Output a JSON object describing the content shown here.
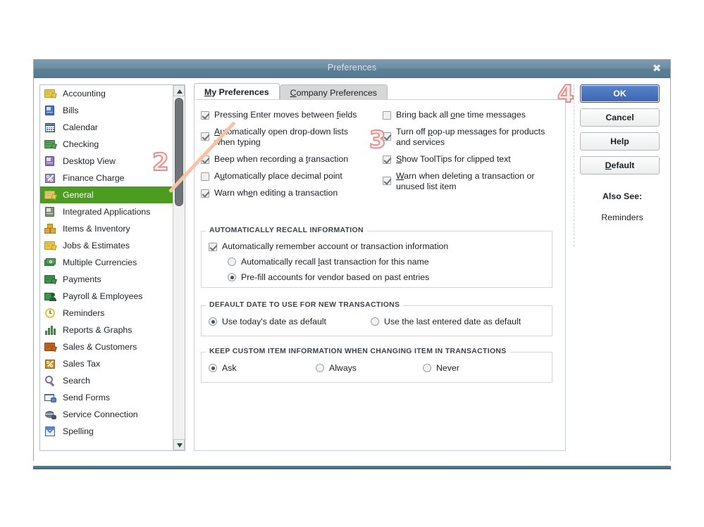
{
  "window": {
    "title": "Preferences",
    "close_icon": "close-icon",
    "close_glyph": "✖"
  },
  "sidebar": {
    "items": [
      {
        "label": "Accounting",
        "icon": "accounting-icon",
        "selected": false
      },
      {
        "label": "Bills",
        "icon": "bills-icon",
        "selected": false
      },
      {
        "label": "Calendar",
        "icon": "calendar-icon",
        "selected": false
      },
      {
        "label": "Checking",
        "icon": "checking-icon",
        "selected": false
      },
      {
        "label": "Desktop View",
        "icon": "desktop-view-icon",
        "selected": false
      },
      {
        "label": "Finance Charge",
        "icon": "finance-charge-icon",
        "selected": false
      },
      {
        "label": "General",
        "icon": "general-icon",
        "selected": true
      },
      {
        "label": "Integrated Applications",
        "icon": "integrated-applications-icon",
        "selected": false
      },
      {
        "label": "Items & Inventory",
        "icon": "items-inventory-icon",
        "selected": false
      },
      {
        "label": "Jobs & Estimates",
        "icon": "jobs-estimates-icon",
        "selected": false
      },
      {
        "label": "Multiple Currencies",
        "icon": "multiple-currencies-icon",
        "selected": false
      },
      {
        "label": "Payments",
        "icon": "payments-icon",
        "selected": false
      },
      {
        "label": "Payroll & Employees",
        "icon": "payroll-employees-icon",
        "selected": false
      },
      {
        "label": "Reminders",
        "icon": "reminders-icon",
        "selected": false
      },
      {
        "label": "Reports & Graphs",
        "icon": "reports-graphs-icon",
        "selected": false
      },
      {
        "label": "Sales & Customers",
        "icon": "sales-customers-icon",
        "selected": false
      },
      {
        "label": "Sales Tax",
        "icon": "sales-tax-icon",
        "selected": false
      },
      {
        "label": "Search",
        "icon": "search-icon",
        "selected": false
      },
      {
        "label": "Send Forms",
        "icon": "send-forms-icon",
        "selected": false
      },
      {
        "label": "Service Connection",
        "icon": "service-connection-icon",
        "selected": false
      },
      {
        "label": "Spelling",
        "icon": "spelling-icon",
        "selected": false
      }
    ],
    "selected_color": "#4d9c22"
  },
  "tabs": [
    {
      "label": "My Preferences",
      "accel": "M",
      "active": true
    },
    {
      "label": "Company Preferences",
      "accel": "C",
      "active": false
    }
  ],
  "checkboxes_left": [
    {
      "label": "Pressing Enter moves between fields",
      "accel": "f",
      "checked": true,
      "two_line": false
    },
    {
      "label": "Automatically open drop-down lists when typing",
      "line1": "Automatically open drop-down lists",
      "line2": "when typing",
      "accel": "A",
      "checked": true,
      "two_line": true
    },
    {
      "label": "Beep when recording a transaction",
      "accel": "t",
      "checked": true,
      "two_line": false
    },
    {
      "label": "Automatically place decimal point",
      "accel": "u",
      "checked": false,
      "two_line": false
    },
    {
      "label": "Warn when editing a transaction",
      "accel": "e",
      "checked": true,
      "two_line": false
    }
  ],
  "checkboxes_right": [
    {
      "label": "Bring back all one time messages",
      "accel": "o",
      "checked": false,
      "two_line": false
    },
    {
      "label": "Turn off pop-up messages for products and services",
      "line1": "Turn off pop-up messages for products",
      "line2": "and services",
      "accel": "p",
      "checked": true,
      "two_line": true
    },
    {
      "label": "Show ToolTips for clipped text",
      "accel": "S",
      "checked": true,
      "two_line": false
    },
    {
      "label": "Warn when deleting a transaction or unused list item",
      "line1": "Warn when deleting a transaction or",
      "line2": "unused list item",
      "accel": "W",
      "checked": true,
      "two_line": true
    }
  ],
  "group_recall": {
    "legend": "AUTOMATICALLY RECALL INFORMATION",
    "checkbox": {
      "label": "Automatically remember account or transaction information",
      "checked": true
    },
    "radios": [
      {
        "label": "Automatically recall last transaction for this name",
        "accel": "l",
        "selected": false
      },
      {
        "label": "Pre-fill accounts for vendor based on past entries",
        "selected": true
      }
    ]
  },
  "group_default_date": {
    "legend": "DEFAULT DATE TO USE FOR NEW TRANSACTIONS",
    "radios": [
      {
        "label": "Use today's date as default",
        "selected": true
      },
      {
        "label": "Use the last entered date as default",
        "selected": false
      }
    ]
  },
  "group_custom_item": {
    "legend": "KEEP CUSTOM ITEM INFORMATION WHEN CHANGING ITEM IN TRANSACTIONS",
    "radios": [
      {
        "label": "Ask",
        "selected": true
      },
      {
        "label": "Always",
        "selected": false
      },
      {
        "label": "Never",
        "selected": false
      }
    ]
  },
  "buttons": {
    "ok": "OK",
    "cancel": "Cancel",
    "help": "Help",
    "default": "Default",
    "default_accel": "D",
    "also_see_label": "Also See:",
    "also_see_link": "Reminders",
    "ok_color": "#3a64b5"
  },
  "annotations": [
    {
      "number": "2",
      "color": "#e2928e"
    },
    {
      "number": "3",
      "color": "#e2928e"
    },
    {
      "number": "4",
      "color": "#e2928e"
    }
  ]
}
